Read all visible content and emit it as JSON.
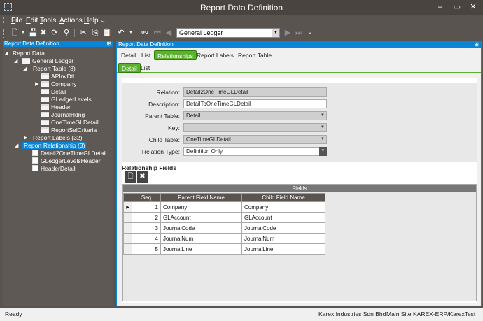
{
  "window": {
    "title": "Report Data Definition",
    "minimize": "–",
    "maximize": "▭",
    "close": "✕"
  },
  "menu": [
    "File",
    "Edit",
    "Tools",
    "Actions",
    "Help"
  ],
  "menu_underline": [
    "F",
    "E",
    "T",
    "A",
    "H"
  ],
  "menu_rest": [
    "ile",
    "dit",
    "ools",
    "ctions",
    "elp"
  ],
  "menu_more": "⌄",
  "toolbar": {
    "new_icon": "new-document-icon",
    "save_icon": "save-icon",
    "delete_icon": "delete-icon",
    "refresh_icon": "refresh-icon",
    "clear_icon": "clear-icon",
    "cut_icon": "cut-icon",
    "copy_icon": "copy-icon",
    "paste_icon": "paste-icon",
    "undo_icon": "undo-icon",
    "find_icon": "binoculars-icon",
    "combo_value": "General Ledger"
  },
  "left_panel": {
    "title": "Report Data Definition",
    "tree": {
      "root": "Report Data",
      "general_ledger": "General Ledger",
      "report_table": "Report Table (8)",
      "tables": [
        "APInvDtl",
        "Company",
        "Detail",
        "GLedgerLevels",
        "Header",
        "JournalHdng",
        "OneTimeGLDetail",
        "ReportSelCriteria"
      ],
      "report_labels": "Report Labels (32)",
      "report_relationship": "Report Relationship (3)",
      "relationships": [
        "Detail2OneTimeGLDetail",
        "GLedgerLevelsHeader",
        "HeaderDetail"
      ]
    }
  },
  "right_panel": {
    "title": "Report Data Definition",
    "tabs": [
      "Detail",
      "List",
      "Relationships",
      "Report Labels",
      "Report Table"
    ],
    "subtabs": [
      "Detail",
      "List"
    ],
    "form": {
      "relation_label": "Relation:",
      "relation_value": "Detail2OneTimeGLDetail",
      "description_label": "Description:",
      "description_value": "DetailToOneTimeGLDetail",
      "parent_table_label": "Parent Table:",
      "parent_table_value": "Detail",
      "key_label": "Key:",
      "key_value": "",
      "child_table_label": "Child Table:",
      "child_table_value": "OneTimeGLDetail",
      "relation_type_label": "Relation Type:",
      "relation_type_value": "Definition Only"
    },
    "fields_section": {
      "title": "Relationship Fields",
      "caption": "Fields",
      "columns": [
        "Seq",
        "Parent Field Name",
        "Child Field Name"
      ],
      "rows": [
        {
          "seq": "1",
          "parent": "Company",
          "child": "Company"
        },
        {
          "seq": "2",
          "parent": "GLAccount",
          "child": "GLAccount"
        },
        {
          "seq": "3",
          "parent": "JournalCode",
          "child": "JournalCode"
        },
        {
          "seq": "4",
          "parent": "JournalNum",
          "child": "JournalNum"
        },
        {
          "seq": "5",
          "parent": "JournalLine",
          "child": "JournalLine"
        }
      ]
    }
  },
  "status": {
    "left": "Ready",
    "company": "Karex Industries Sdn Bhd",
    "site": "Main Site",
    "env": "KAREX-ERP/KarexTest"
  },
  "colors": {
    "accent_blue": "#0a84d6",
    "tab_green": "#5cb22c",
    "chrome": "#5a5451"
  }
}
